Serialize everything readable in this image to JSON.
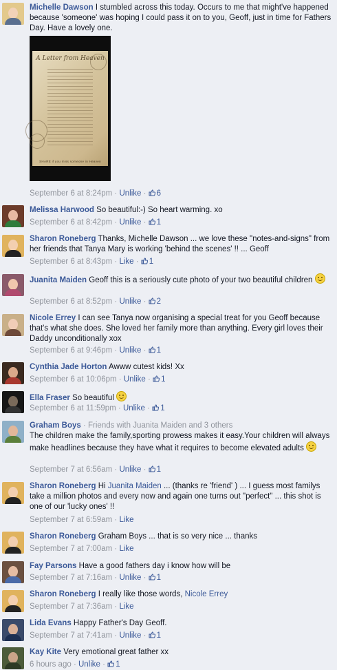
{
  "comments": [
    {
      "name": "Michelle Dawson",
      "text": "I stumbled across this today. Occurs to me that might've happened because 'someone' was hoping I could pass it on to you, Geoff, just in time for Fathers Day. Have a lovely one.",
      "time": "September 6 at 8:24pm",
      "action": "Unlike",
      "likes": "6",
      "photo_title": "A Letter from Heaven",
      "photo_footer": "SHARE if you miss someone in Heaven"
    },
    {
      "name": "Melissa Harwood",
      "text": "So beautiful:-) So heart warming. xo",
      "time": "September 6 at 8:42pm",
      "action": "Unlike",
      "likes": "1"
    },
    {
      "name": "Sharon Roneberg",
      "text": "Thanks, Michelle Dawson ... we love these \"notes-and-signs\" from her friends that Tanya Mary is working 'behind the scenes' !! ... Geoff",
      "time": "September 6 at 8:43pm",
      "action": "Like",
      "likes": "1"
    },
    {
      "name": "Juanita Maiden",
      "text": "Geoff this is a seriously cute photo of your two beautiful children",
      "time": "September 6 at 8:52pm",
      "action": "Unlike",
      "likes": "2"
    },
    {
      "name": "Nicole Errey",
      "text": "I can see Tanya now organising a special treat for you Geoff because that's what she does. She loved her family more than anything. Every girl loves their Daddy unconditionally xox",
      "time": "September 6 at 9:46pm",
      "action": "Unlike",
      "likes": "1"
    },
    {
      "name": "Cynthia Jade Horton",
      "text": "Awww cutest kids! Xx",
      "time": "September 6 at 10:06pm",
      "action": "Unlike",
      "likes": "1"
    },
    {
      "name": "Ella Fraser",
      "text": "So beautiful",
      "time": "September 6 at 11:59pm",
      "action": "Unlike",
      "likes": "1"
    },
    {
      "name": "Graham Boys",
      "friends": "· Friends with Juanita Maiden and 3 others",
      "text": "The children make the family,sporting prowess makes it easy.Your children will always make headlines because they have what it requires to become elevated adults",
      "time": "September 7 at 6:56am",
      "action": "Unlike",
      "likes": "1"
    },
    {
      "name": "Sharon Roneberg",
      "mention": "Juanita Maiden",
      "text_pre": "Hi",
      "text": "... (thanks re 'friend' ) ... I guess most familys take a million photos and every now and again one turns out \"perfect\" ... this shot is one of our 'lucky ones' !!",
      "time": "September 7 at 6:59am",
      "action": "Like"
    },
    {
      "name": "Sharon Roneberg",
      "text": "Graham Boys ... that is so very nice ... thanks",
      "time": "September 7 at 7:00am",
      "action": "Like"
    },
    {
      "name": "Fay Parsons",
      "text": "Have a good fathers day i know how will be",
      "time": "September 7 at 7:16am",
      "action": "Unlike",
      "likes": "1"
    },
    {
      "name": "Sharon Roneberg",
      "text": "I really like those words,",
      "mention": "Nicole Errey",
      "time": "September 7 at 7:36am",
      "action": "Like"
    },
    {
      "name": "Lida Evans",
      "text": "Happy Father's Day Geoff.",
      "time": "September 7 at 7:41am",
      "action": "Unlike",
      "likes": "1"
    },
    {
      "name": "Kay Kite",
      "text": "Very emotional great father xx",
      "time": "6 hours ago",
      "action": "Unlike",
      "likes": "1"
    }
  ],
  "sep": "·",
  "colors": {
    "link": "#3b5998",
    "meta": "#90949c",
    "bg": "#edeff4"
  }
}
